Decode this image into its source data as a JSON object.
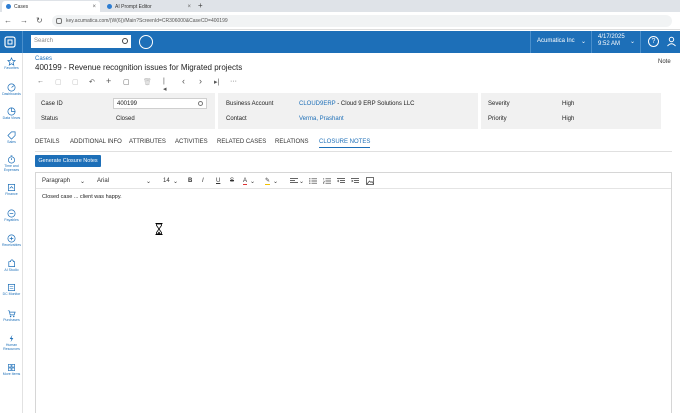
{
  "browser": {
    "tabs": [
      {
        "label": "Cases",
        "close": "×"
      },
      {
        "label": "AI Prompt Editor",
        "close": "×"
      }
    ],
    "new_tab": "+",
    "url": "key.acumatica.com/(W(6))/Main?ScreenId=CR306000&CaseCD=400199",
    "nav": {
      "back": "←",
      "forward": "→",
      "reload": "↻"
    }
  },
  "header": {
    "search_placeholder": "Search",
    "tenant": "Acumatica Inc",
    "date": "4/17/2025",
    "time": "9:52 AM",
    "help": "?",
    "chevron": "⌄",
    "brand_color": "#1d6fb8"
  },
  "sidebar": {
    "items": [
      {
        "label": "Favorites",
        "icon": "star-icon"
      },
      {
        "label": "Dashboards",
        "icon": "dashboard-icon"
      },
      {
        "label": "Data Views",
        "icon": "data-views-icon"
      },
      {
        "label": "Sales",
        "icon": "tag-icon"
      },
      {
        "label": "Time and Expenses",
        "icon": "stopwatch-icon"
      },
      {
        "label": "Finance",
        "icon": "finance-icon"
      },
      {
        "label": "Payables",
        "icon": "minus-circle-icon"
      },
      {
        "label": "Receivables",
        "icon": "plus-circle-icon"
      },
      {
        "label": "AI Studio",
        "icon": "puzzle-icon"
      },
      {
        "label": "DC Monitor",
        "icon": "monitor-icon"
      },
      {
        "label": "Purchases",
        "icon": "cart-icon"
      },
      {
        "label": "Human Resources",
        "icon": "bolt-icon"
      },
      {
        "label": "More Items",
        "icon": "grid-icon"
      }
    ]
  },
  "page": {
    "breadcrumb": "Cases",
    "title": "400199 - Revenue recognition issues for Migrated projects",
    "notes_link": "Note",
    "toolbar": {
      "back": "←",
      "save": "▢",
      "copy": "▢",
      "undo": "↶",
      "add": "+",
      "clipboard": "▢",
      "delete": "🗑",
      "first": "|◂",
      "prev": "‹",
      "next": "›",
      "last": "▸|",
      "more": "···"
    },
    "form": {
      "case_id_label": "Case ID",
      "case_id_value": "400199",
      "status_label": "Status",
      "status_value": "Closed",
      "business_account_label": "Business Account",
      "business_account_code": "CLOUD9ERP",
      "business_account_name": " - Cloud 9 ERP Solutions LLC",
      "contact_label": "Contact",
      "contact_value": "Verma, Prashant",
      "severity_label": "Severity",
      "severity_value": "High",
      "priority_label": "Priority",
      "priority_value": "High"
    },
    "tabs": [
      {
        "label": "DETAILS"
      },
      {
        "label": "ADDITIONAL INFO"
      },
      {
        "label": "ATTRIBUTES"
      },
      {
        "label": "ACTIVITIES"
      },
      {
        "label": "RELATED CASES"
      },
      {
        "label": "RELATIONS"
      },
      {
        "label": "CLOSURE NOTES",
        "active": true
      }
    ],
    "generate_button": "Generate Closure Notes",
    "editor": {
      "paragraph": "Paragraph",
      "font": "Arial",
      "size": "14",
      "bold": "B",
      "italic": "I",
      "underline": "U",
      "strike": "S",
      "font_color": "A",
      "highlight": "✎",
      "content": "Closed case ... client was happy."
    }
  }
}
